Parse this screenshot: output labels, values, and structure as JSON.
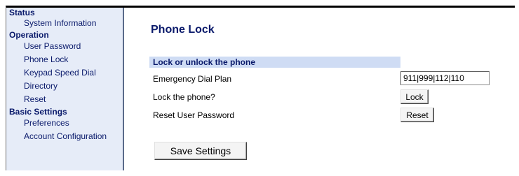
{
  "sidebar": {
    "sections": [
      {
        "title": "Status",
        "items": [
          "System Information"
        ]
      },
      {
        "title": "Operation",
        "items": [
          "User Password",
          "Phone Lock",
          "Keypad Speed Dial",
          "Directory",
          "Reset"
        ]
      },
      {
        "title": "Basic Settings",
        "items": [
          "Preferences",
          "Account Configuration"
        ]
      }
    ]
  },
  "main": {
    "title": "Phone Lock",
    "section_header": "Lock or unlock the phone",
    "rows": [
      {
        "label": "Emergency Dial Plan",
        "value": "911|999|112|110"
      },
      {
        "label": "Lock the phone?",
        "button": "Lock"
      },
      {
        "label": "Reset User Password",
        "button": "Reset"
      }
    ],
    "save_label": "Save Settings"
  },
  "colors": {
    "sidebar_bg": "#e6ecf8",
    "link_text": "#0a1a6b",
    "section_bar_bg": "#cfdcf4"
  }
}
